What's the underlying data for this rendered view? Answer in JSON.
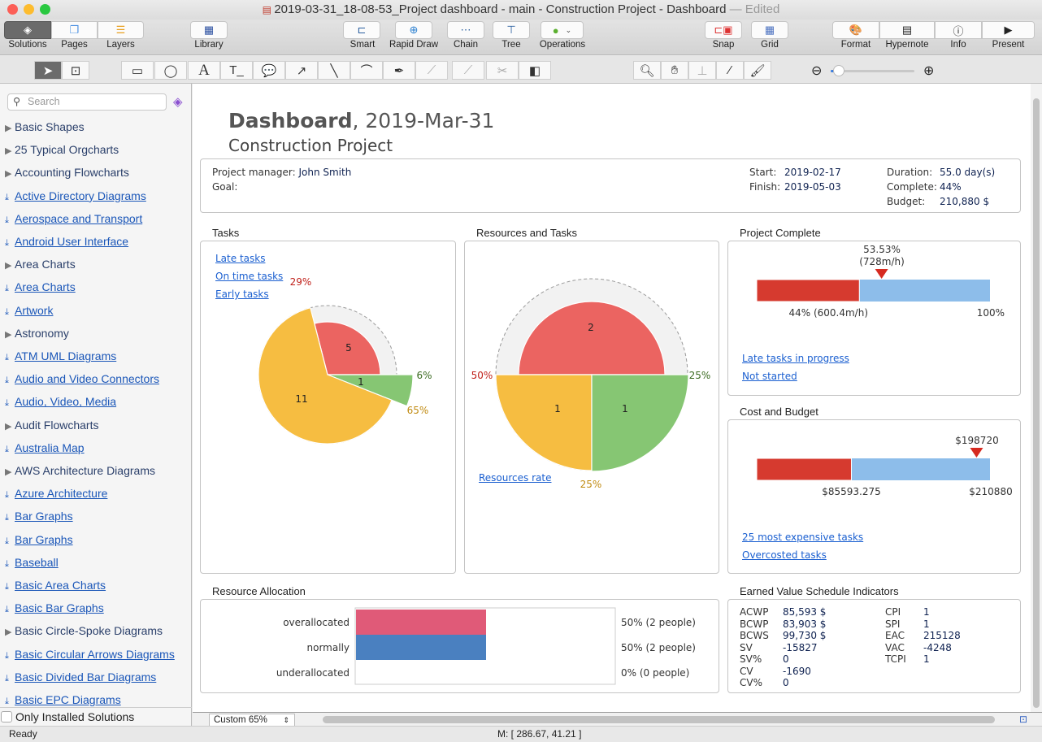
{
  "window": {
    "title": "2019-03-31_18-08-53_Project dashboard - main - Construction Project - Dashboard",
    "edited": "— Edited"
  },
  "toolbar": {
    "solutions": "Solutions",
    "pages": "Pages",
    "layers": "Layers",
    "library": "Library",
    "smart": "Smart",
    "rapid_draw": "Rapid Draw",
    "chain": "Chain",
    "tree": "Tree",
    "operations": "Operations",
    "snap": "Snap",
    "grid": "Grid",
    "format": "Format",
    "hypernote": "Hypernote",
    "info": "Info",
    "present": "Present"
  },
  "zoom_slider": {
    "value_percent": 10
  },
  "sidebar": {
    "search_placeholder": "Search",
    "only_installed": "Only Installed Solutions",
    "items": [
      {
        "label": "Basic Shapes",
        "type": "category"
      },
      {
        "label": "25 Typical Orgcharts",
        "type": "category"
      },
      {
        "label": "Accounting Flowcharts",
        "type": "category"
      },
      {
        "label": "Active Directory Diagrams",
        "type": "download"
      },
      {
        "label": "Aerospace and Transport",
        "type": "download"
      },
      {
        "label": "Android User Interface",
        "type": "download"
      },
      {
        "label": "Area Charts",
        "type": "category"
      },
      {
        "label": "Area Charts",
        "type": "download"
      },
      {
        "label": "Artwork",
        "type": "download"
      },
      {
        "label": "Astronomy",
        "type": "category"
      },
      {
        "label": "ATM UML Diagrams",
        "type": "download"
      },
      {
        "label": "Audio and Video Connectors",
        "type": "download"
      },
      {
        "label": "Audio, Video, Media",
        "type": "download"
      },
      {
        "label": "Audit Flowcharts",
        "type": "category"
      },
      {
        "label": "Australia Map",
        "type": "download"
      },
      {
        "label": "AWS Architecture Diagrams",
        "type": "category"
      },
      {
        "label": "Azure Architecture",
        "type": "download"
      },
      {
        "label": "Bar Graphs",
        "type": "download"
      },
      {
        "label": "Bar Graphs",
        "type": "download"
      },
      {
        "label": "Baseball",
        "type": "download"
      },
      {
        "label": "Basic Area Charts",
        "type": "download"
      },
      {
        "label": "Basic Bar Graphs",
        "type": "download"
      },
      {
        "label": "Basic Circle-Spoke Diagrams",
        "type": "category"
      },
      {
        "label": "Basic Circular Arrows Diagrams",
        "type": "download"
      },
      {
        "label": "Basic Divided Bar Diagrams",
        "type": "download"
      },
      {
        "label": "Basic EPC Diagrams",
        "type": "download"
      }
    ]
  },
  "dashboard": {
    "title_bold": "Dashboard",
    "title_date": ", 2019-Mar-31",
    "subtitle": "Construction Project",
    "info": {
      "pm_label": "Project manager:",
      "pm": "John Smith",
      "goal_label": "Goal:",
      "start_label": "Start:",
      "start": "2019-02-17",
      "finish_label": "Finish:",
      "finish": "2019-05-03",
      "duration_label": "Duration:",
      "duration": "55.0 day(s)",
      "complete_label": "Complete:",
      "complete": "44%",
      "budget_label": "Budget:",
      "budget": "210,880 $"
    },
    "tasks": {
      "title": "Tasks",
      "links": [
        "Late tasks",
        "On time tasks",
        "Early tasks"
      ],
      "slices": [
        {
          "name": "Late",
          "count": "5",
          "percent": "29%",
          "color": "#eb6461"
        },
        {
          "name": "Early",
          "count": "1",
          "percent": "6%",
          "color": "#86c673"
        },
        {
          "name": "On time",
          "count": "11",
          "percent": "65%",
          "color": "#f6bd41"
        }
      ]
    },
    "resources": {
      "title": "Resources and Tasks",
      "link": "Resources rate",
      "slices": [
        {
          "count": "2",
          "percent": "50%",
          "color": "#eb6461"
        },
        {
          "count": "1",
          "percent": "25%",
          "color": "#f6bd41"
        },
        {
          "count": "1",
          "percent": "25%",
          "color": "#86c673"
        }
      ]
    },
    "project_complete": {
      "title": "Project Complete",
      "marker": "53.53%",
      "marker_sub": "(728m/h)",
      "marker_value": 53.53,
      "done_value": 44,
      "done_label": "44% (600.4m/h)",
      "end_label": "100%",
      "links": [
        "Late tasks in progress",
        "Not started"
      ]
    },
    "cost": {
      "title": "Cost and Budget",
      "marker": "$198720",
      "marker_value": 198720,
      "spent": 85593.275,
      "spent_label": "$85593.275",
      "budget": 210880,
      "budget_label": "$210880",
      "links": [
        "25 most expensive tasks",
        "Overcosted tasks"
      ]
    },
    "allocation": {
      "title": "Resource Allocation",
      "rows": [
        {
          "label": "overallocated",
          "value": 50,
          "text": "50% (2 people)",
          "color": "#e05a78"
        },
        {
          "label": "normally",
          "value": 50,
          "text": "50% (2 people)",
          "color": "#4a80c0"
        },
        {
          "label": "underallocated",
          "value": 0,
          "text": "0% (0 people)",
          "color": "#cccccc"
        }
      ]
    },
    "ev": {
      "title": "Earned Value Schedule Indicators",
      "left": [
        [
          "ACWP",
          "85,593 $"
        ],
        [
          "BCWP",
          "83,903 $"
        ],
        [
          "BCWS",
          "99,730 $"
        ],
        [
          "SV",
          "-15827"
        ],
        [
          "SV%",
          "0"
        ],
        [
          "CV",
          "-1690"
        ],
        [
          "CV%",
          "0"
        ]
      ],
      "right": [
        [
          "CPI",
          "1"
        ],
        [
          "SPI",
          "1"
        ],
        [
          "EAC",
          "215128"
        ],
        [
          "VAC",
          "-4248"
        ],
        [
          "TCPI",
          "1"
        ]
      ]
    },
    "colors": {
      "red": "#d63a2f",
      "blue": "#8dbdea"
    }
  },
  "bottom": {
    "zoom": "Custom 65%",
    "status": "Ready",
    "mouse": "M: [ 286.67, 41.21 ]"
  }
}
